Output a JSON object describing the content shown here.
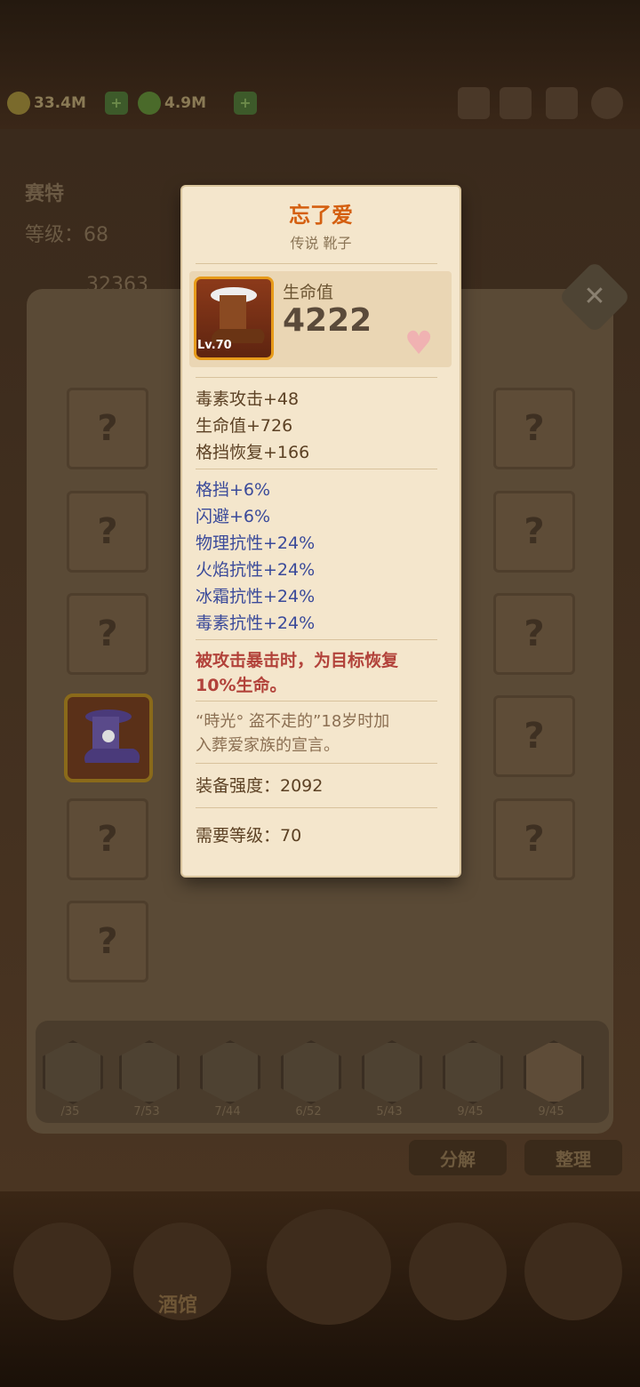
{
  "header": {
    "gold": "33.4M",
    "gems": "4.9M"
  },
  "hero": {
    "name": "赛特",
    "level_label": "等级：68",
    "hp_partial": "32363"
  },
  "inventory": {
    "unknown_symbol": "?",
    "tabs": [
      {
        "count": "/35",
        "icon": "scroll-icon"
      },
      {
        "count": "7/53",
        "icon": "armor-icon"
      },
      {
        "count": "7/44",
        "icon": "mirror-icon"
      },
      {
        "count": "6/52",
        "icon": "shirt-icon"
      },
      {
        "count": "5/43",
        "icon": "glove-icon"
      },
      {
        "count": "9/45",
        "icon": "ring-icon"
      },
      {
        "count": "9/45",
        "icon": "boot-icon"
      }
    ],
    "decompose_label": "分解",
    "sort_label": "整理"
  },
  "bottom_nav": {
    "tavern_label": "酒馆"
  },
  "tooltip": {
    "name": "忘了爱",
    "subtitle": "传说 靴子",
    "item_level": "Lv.70",
    "hp_label": "生命值",
    "hp_value": "4222",
    "base_stats": [
      "毒素攻击+48",
      "生命值+726",
      "格挡恢复+166"
    ],
    "bonus_stats": [
      "格挡+6%",
      "闪避+6%",
      "物理抗性+24%",
      "火焰抗性+24%",
      "冰霜抗性+24%",
      "毒素抗性+24%"
    ],
    "special_line1": "被攻击暴击时，为目标恢复",
    "special_line2": "10%生命。",
    "lore_line1": "“時光° 盗不走的”18岁时加",
    "lore_line2": "入葬爱家族的宣言。",
    "power_label": "装备强度：2092",
    "req_label": "需要等级：70"
  }
}
